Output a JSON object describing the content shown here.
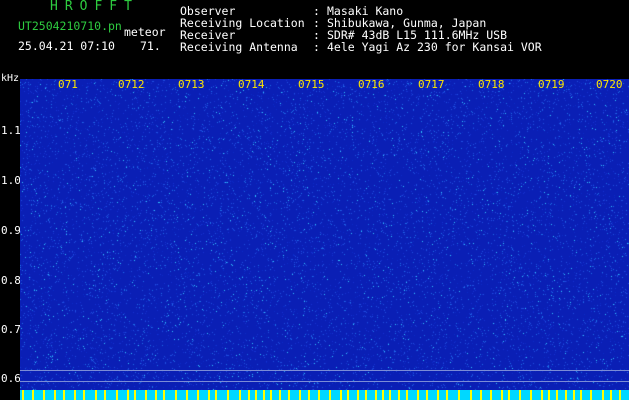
{
  "header": {
    "brand": "HROFFT",
    "filename": "UT2504210710.pn",
    "tag": "meteor",
    "datetime": "25.04.21 07:10",
    "count": "71.",
    "fields": [
      {
        "label": "Observer",
        "value": "Masaki Kano"
      },
      {
        "label": "Receiving Location",
        "value": "Shibukawa, Gunma, Japan"
      },
      {
        "label": "Receiver",
        "value": "SDR# 43dB L15 111.6MHz USB"
      },
      {
        "label": "Receiving Antenna",
        "value": "4ele Yagi Az 230 for Kansai VOR"
      }
    ],
    "separator": ":"
  },
  "spectrogram": {
    "y_unit": "kHz",
    "y_ticks": [
      "1.1",
      "1.0",
      "0.9",
      "0.8",
      "0.7",
      "0.6"
    ],
    "x_ticks": [
      "071",
      "0712",
      "0713",
      "0714",
      "0715",
      "0716",
      "0717",
      "0718",
      "0719",
      "0720"
    ],
    "colors": {
      "background": "#0a1fb5",
      "speckle": "#33c7ff",
      "tick_text": "#ffe600",
      "baseline": "#00d8ff",
      "baseline_mark": "#ffff00"
    }
  }
}
